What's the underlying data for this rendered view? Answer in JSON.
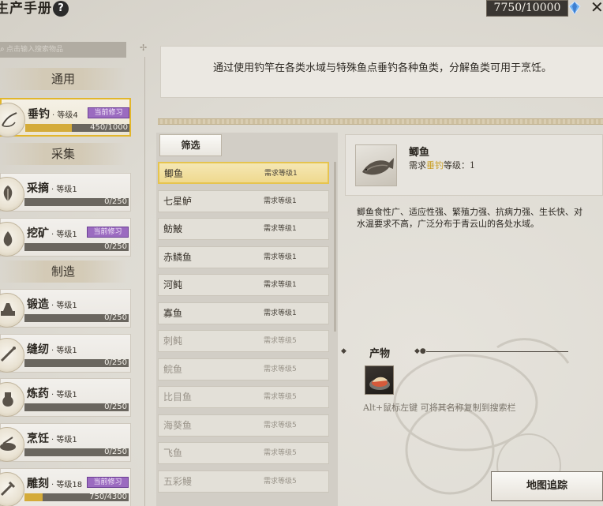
{
  "window": {
    "title": "生产手册",
    "currency_text": "7750/10000"
  },
  "sidebar": {
    "search_placeholder": "点击输入搜索物品",
    "categories": [
      {
        "label": "通用"
      },
      {
        "label": "采集"
      },
      {
        "label": "制造"
      }
    ],
    "skills": [
      {
        "name": "垂钓",
        "level": "· 等级4",
        "badge": "当前修习",
        "progress_text": "450/1000",
        "progress": 0.45,
        "active": true
      },
      {
        "name": "采摘",
        "level": "· 等级1",
        "badge": "",
        "progress_text": "0/250",
        "progress": 0
      },
      {
        "name": "挖矿",
        "level": "· 等级1",
        "badge": "当前修习",
        "progress_text": "0/250",
        "progress": 0
      },
      {
        "name": "锻造",
        "level": "· 等级1",
        "badge": "",
        "progress_text": "0/250",
        "progress": 0
      },
      {
        "name": "缝纫",
        "level": "· 等级1",
        "badge": "",
        "progress_text": "0/250",
        "progress": 0
      },
      {
        "name": "炼药",
        "level": "· 等级1",
        "badge": "",
        "progress_text": "0/250",
        "progress": 0
      },
      {
        "name": "烹饪",
        "level": "· 等级1",
        "badge": "",
        "progress_text": "0/250",
        "progress": 0
      },
      {
        "name": "雕刻",
        "level": "· 等级18",
        "badge": "当前修习",
        "progress_text": "750/4300",
        "progress": 0.174
      }
    ]
  },
  "main": {
    "description": "通过使用钓竿在各类水域与特殊鱼点垂钓各种鱼类，分解鱼类可用于烹饪。",
    "filter_label": "筛选",
    "fish": [
      {
        "name": "鲫鱼",
        "req": "需求等级1",
        "selected": true
      },
      {
        "name": "七星鲈",
        "req": "需求等级1"
      },
      {
        "name": "鲂鮍",
        "req": "需求等级1"
      },
      {
        "name": "赤鳞鱼",
        "req": "需求等级1"
      },
      {
        "name": "河鲀",
        "req": "需求等级1"
      },
      {
        "name": "寡鱼",
        "req": "需求等级1"
      },
      {
        "name": "刺鲀",
        "req": "需求等级5",
        "locked": true
      },
      {
        "name": "鲩鱼",
        "req": "需求等级5",
        "locked": true
      },
      {
        "name": "比目鱼",
        "req": "需求等级5",
        "locked": true
      },
      {
        "name": "海葵鱼",
        "req": "需求等级5",
        "locked": true
      },
      {
        "name": "飞鱼",
        "req": "需求等级5",
        "locked": true
      },
      {
        "name": "五彩鳗",
        "req": "需求等级5",
        "locked": true
      }
    ]
  },
  "detail": {
    "name": "鲫鱼",
    "req_prefix": "需求",
    "req_skill": "垂钓",
    "req_suffix": "等级：1",
    "description": "鲫鱼食性广、适应性强、繁殖力强、抗病力强、生长快、对\n水温要求不高，广泛分布于青云山的各处水域。",
    "product_title": "产物",
    "hint": "Alt+鼠标左键 可将其名称复制到搜索栏",
    "map_button": "地图追踪"
  }
}
